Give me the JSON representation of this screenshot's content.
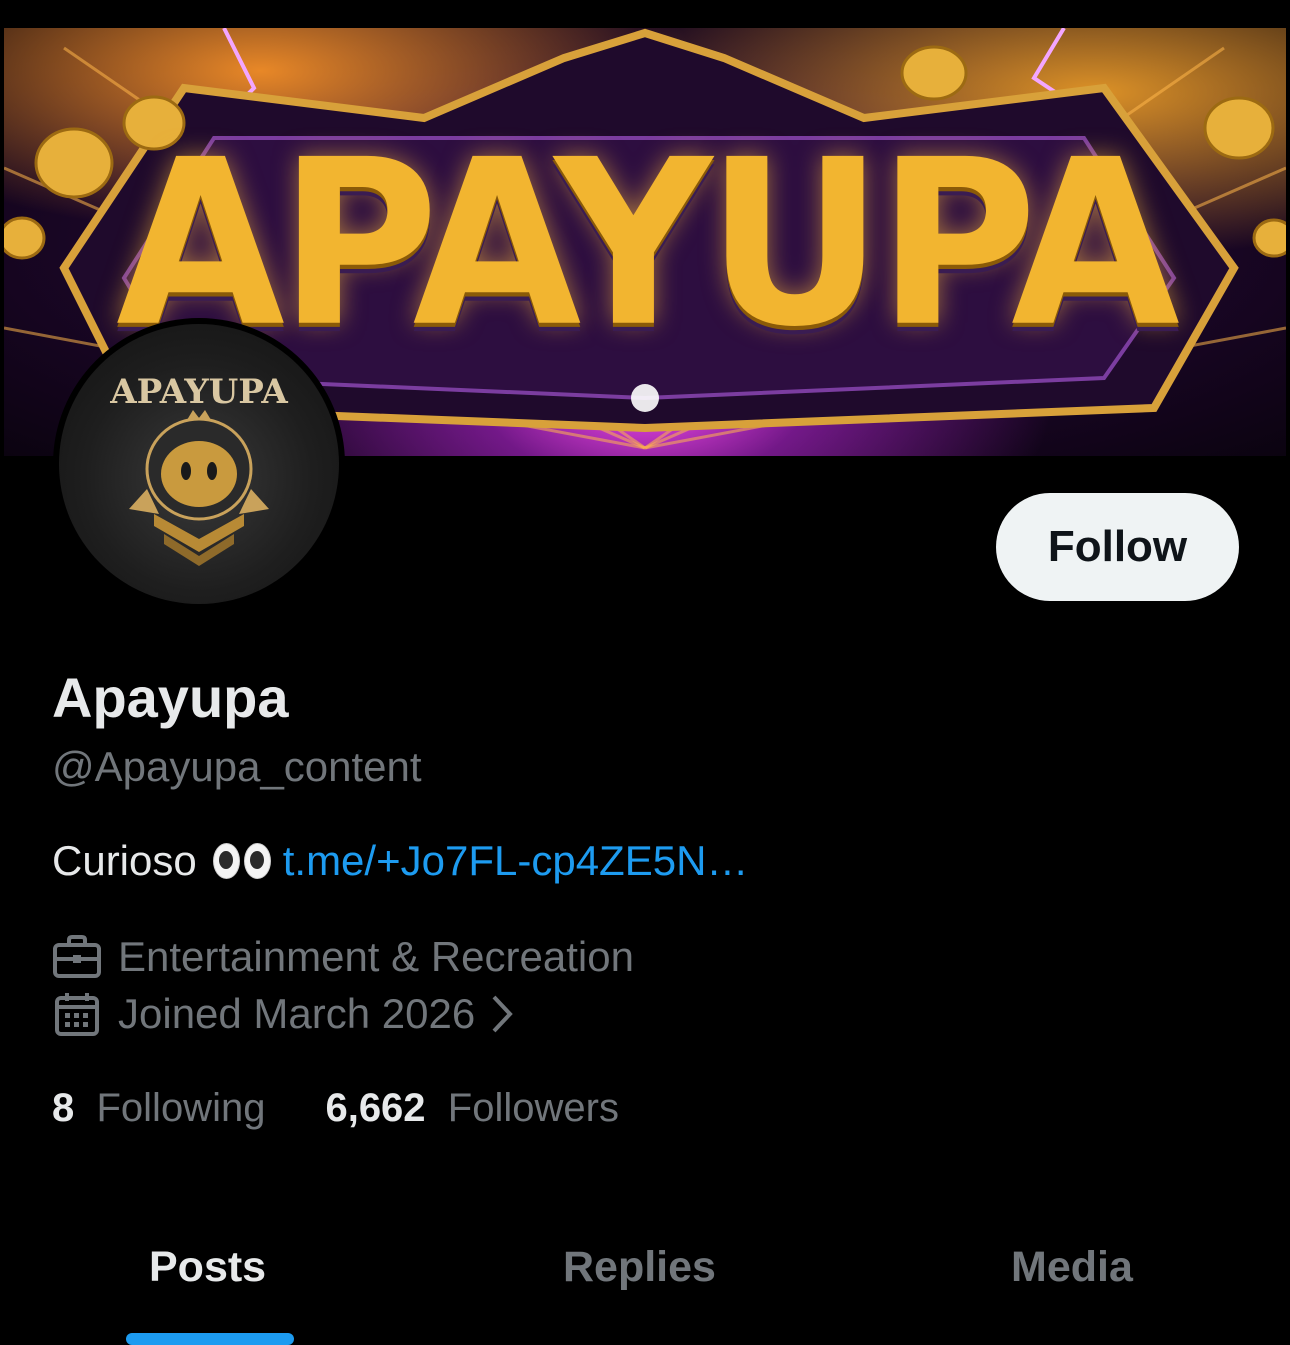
{
  "banner": {
    "text": "APAYUPA",
    "accent_colors": [
      "#f2b530",
      "#3b0d55",
      "#ff4df2"
    ]
  },
  "avatar": {
    "text": "APAYUPA",
    "icon": "mascot-emblem-icon"
  },
  "follow_button": {
    "label": "Follow"
  },
  "profile": {
    "name": "Apayupa",
    "handle": "@Apayupa_content",
    "bio_text": "Curioso",
    "bio_emoji": "eyes-emoji",
    "bio_link": "t.me/+Jo7FL-cp4ZE5N…",
    "category": "Entertainment & Recreation",
    "joined": "Joined March 2026"
  },
  "stats": {
    "following_count": "8",
    "following_label": "Following",
    "followers_count": "6,662",
    "followers_label": "Followers"
  },
  "tabs": [
    {
      "label": "Posts",
      "active": true
    },
    {
      "label": "Replies",
      "active": false
    },
    {
      "label": "Media",
      "active": false
    }
  ],
  "colors": {
    "background": "#000000",
    "text_primary": "#e7e9ea",
    "text_secondary": "#71767b",
    "link": "#1d9bf0",
    "follow_button_bg": "#eff3f4"
  }
}
